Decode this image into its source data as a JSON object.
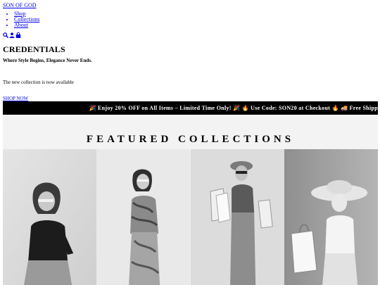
{
  "header": {
    "brand": "SON OF GOD",
    "nav": [
      "Shop",
      "Collections",
      "About"
    ],
    "icons": [
      "search-icon",
      "user-icon",
      "bag-icon"
    ]
  },
  "hero": {
    "title": "CREDENTIALS",
    "tagline": "Where Style Begins, Elegance Never Ends.",
    "note": "The new collection is now available",
    "cta": "SHOP NOW"
  },
  "promo": {
    "text": "🎉 Enjoy 20% OFF on All Items – Limited Time Only! 🎉 🔥 Use Code: SON20 at Checkout 🔥 🚚 Free Shipp"
  },
  "featured": {
    "title": "FEATURED COLLECTIONS"
  },
  "colors": {
    "link": "#0000ee",
    "banner_bg": "#000000",
    "banner_text": "#ffffff",
    "section_bg": "#f3f3f3"
  }
}
